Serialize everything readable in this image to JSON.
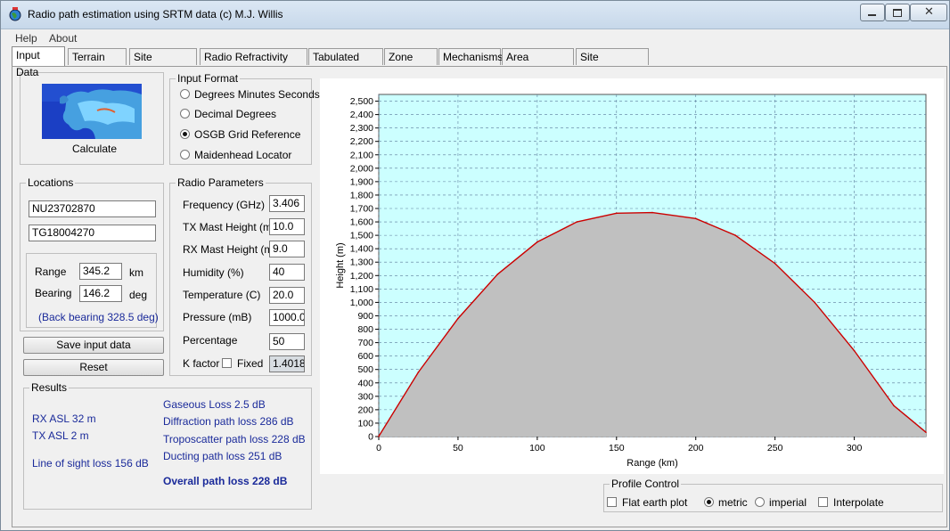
{
  "window": {
    "title": "Radio path estimation using SRTM data (c) M.J. Willis",
    "icon": "globe-icon"
  },
  "menu": [
    "Help",
    "About"
  ],
  "tabs": [
    "Input Data",
    "Terrain Map",
    "Site Database",
    "Radio Refractivity Data",
    "Tabulated Data",
    "Zone Map",
    "Mechanisms",
    "Area Coverage",
    "Site Evaluation"
  ],
  "active_tab": "Input Data",
  "calculate": {
    "label": "Calculate",
    "icon": "europe-map-icon"
  },
  "input_format": {
    "title": "Input Format",
    "options": [
      "Degrees Minutes Seconds",
      "Decimal Degrees",
      "OSGB Grid Reference",
      "Maidenhead Locator"
    ],
    "selected": "OSGB Grid Reference"
  },
  "locations": {
    "title": "Locations",
    "loc1": "NU23702870",
    "loc2": "TG18004270",
    "range_label": "Range",
    "range_value": "345.2",
    "range_unit": "km",
    "bearing_label": "Bearing",
    "bearing_value": "146.2",
    "bearing_unit": "deg",
    "back_bearing": "(Back bearing 328.5 deg)"
  },
  "buttons": {
    "save": "Save input data",
    "reset": "Reset"
  },
  "radio_params": {
    "title": "Radio Parameters",
    "frequency_label": "Frequency (GHz)",
    "frequency": "3.406",
    "tx_label": "TX Mast Height (m)",
    "tx": "10.0",
    "rx_label": "RX Mast Height (m)",
    "rx": "9.0",
    "humidity_label": "Humidity (%)",
    "humidity": "40",
    "temperature_label": "Temperature (C)",
    "temperature": "20.0",
    "pressure_label": "Pressure (mB)",
    "pressure": "1000.0",
    "percentage_label": "Percentage",
    "percentage": "50",
    "kfactor_label": "K factor",
    "fixed_label": "Fixed",
    "kfactor": "1.4018"
  },
  "results": {
    "title": "Results",
    "rx_asl": "RX ASL 32 m",
    "tx_asl": "TX ASL 2 m",
    "los": "Line of sight loss 156 dB",
    "gaseous": "Gaseous Loss 2.5 dB",
    "diffraction": "Diffraction path loss 286 dB",
    "troposcatter": "Troposcatter path loss 228 dB",
    "ducting": "Ducting path loss 251 dB",
    "overall": "Overall path loss 228 dB"
  },
  "profile_control": {
    "title": "Profile Control",
    "flat_earth": "Flat earth plot",
    "metric": "metric",
    "imperial": "imperial",
    "interpolate": "Interpolate",
    "units_selected": "metric"
  },
  "colors": {
    "plot_bg": "#ccffff",
    "terrain": "#c0c0c0",
    "ray": "#cc0000",
    "result_text": "#1a2a9a"
  },
  "chart_data": {
    "type": "area",
    "xlabel": "Range (km)",
    "ylabel": "Height (m)",
    "xlim": [
      0,
      345.2
    ],
    "ylim": [
      0,
      2550
    ],
    "xticks": [
      0,
      50,
      100,
      150,
      200,
      250,
      300
    ],
    "yticks": [
      0,
      100,
      200,
      300,
      400,
      500,
      600,
      700,
      800,
      900,
      1000,
      1100,
      1200,
      1300,
      1400,
      1500,
      1600,
      1700,
      1800,
      1900,
      2000,
      2100,
      2200,
      2300,
      2400,
      2500
    ],
    "ytick_labels": [
      "0",
      "100",
      "200",
      "300",
      "400",
      "500",
      "600",
      "700",
      "800",
      "900",
      "1,000",
      "1,100",
      "1,200",
      "1,300",
      "1,400",
      "1,500",
      "1,600",
      "1,700",
      "1,800",
      "1,900",
      "2,000",
      "2,100",
      "2,200",
      "2,300",
      "2,400",
      "2,500"
    ],
    "grid": true,
    "series": [
      {
        "values_x": [
          0,
          25,
          50,
          75,
          100,
          125,
          150,
          172.6,
          200,
          225,
          250,
          275,
          300,
          325,
          345.2
        ],
        "values_y": [
          2,
          480,
          880,
          1210,
          1450,
          1600,
          1665,
          1670,
          1625,
          1500,
          1290,
          1000,
          640,
          230,
          32
        ]
      }
    ]
  }
}
